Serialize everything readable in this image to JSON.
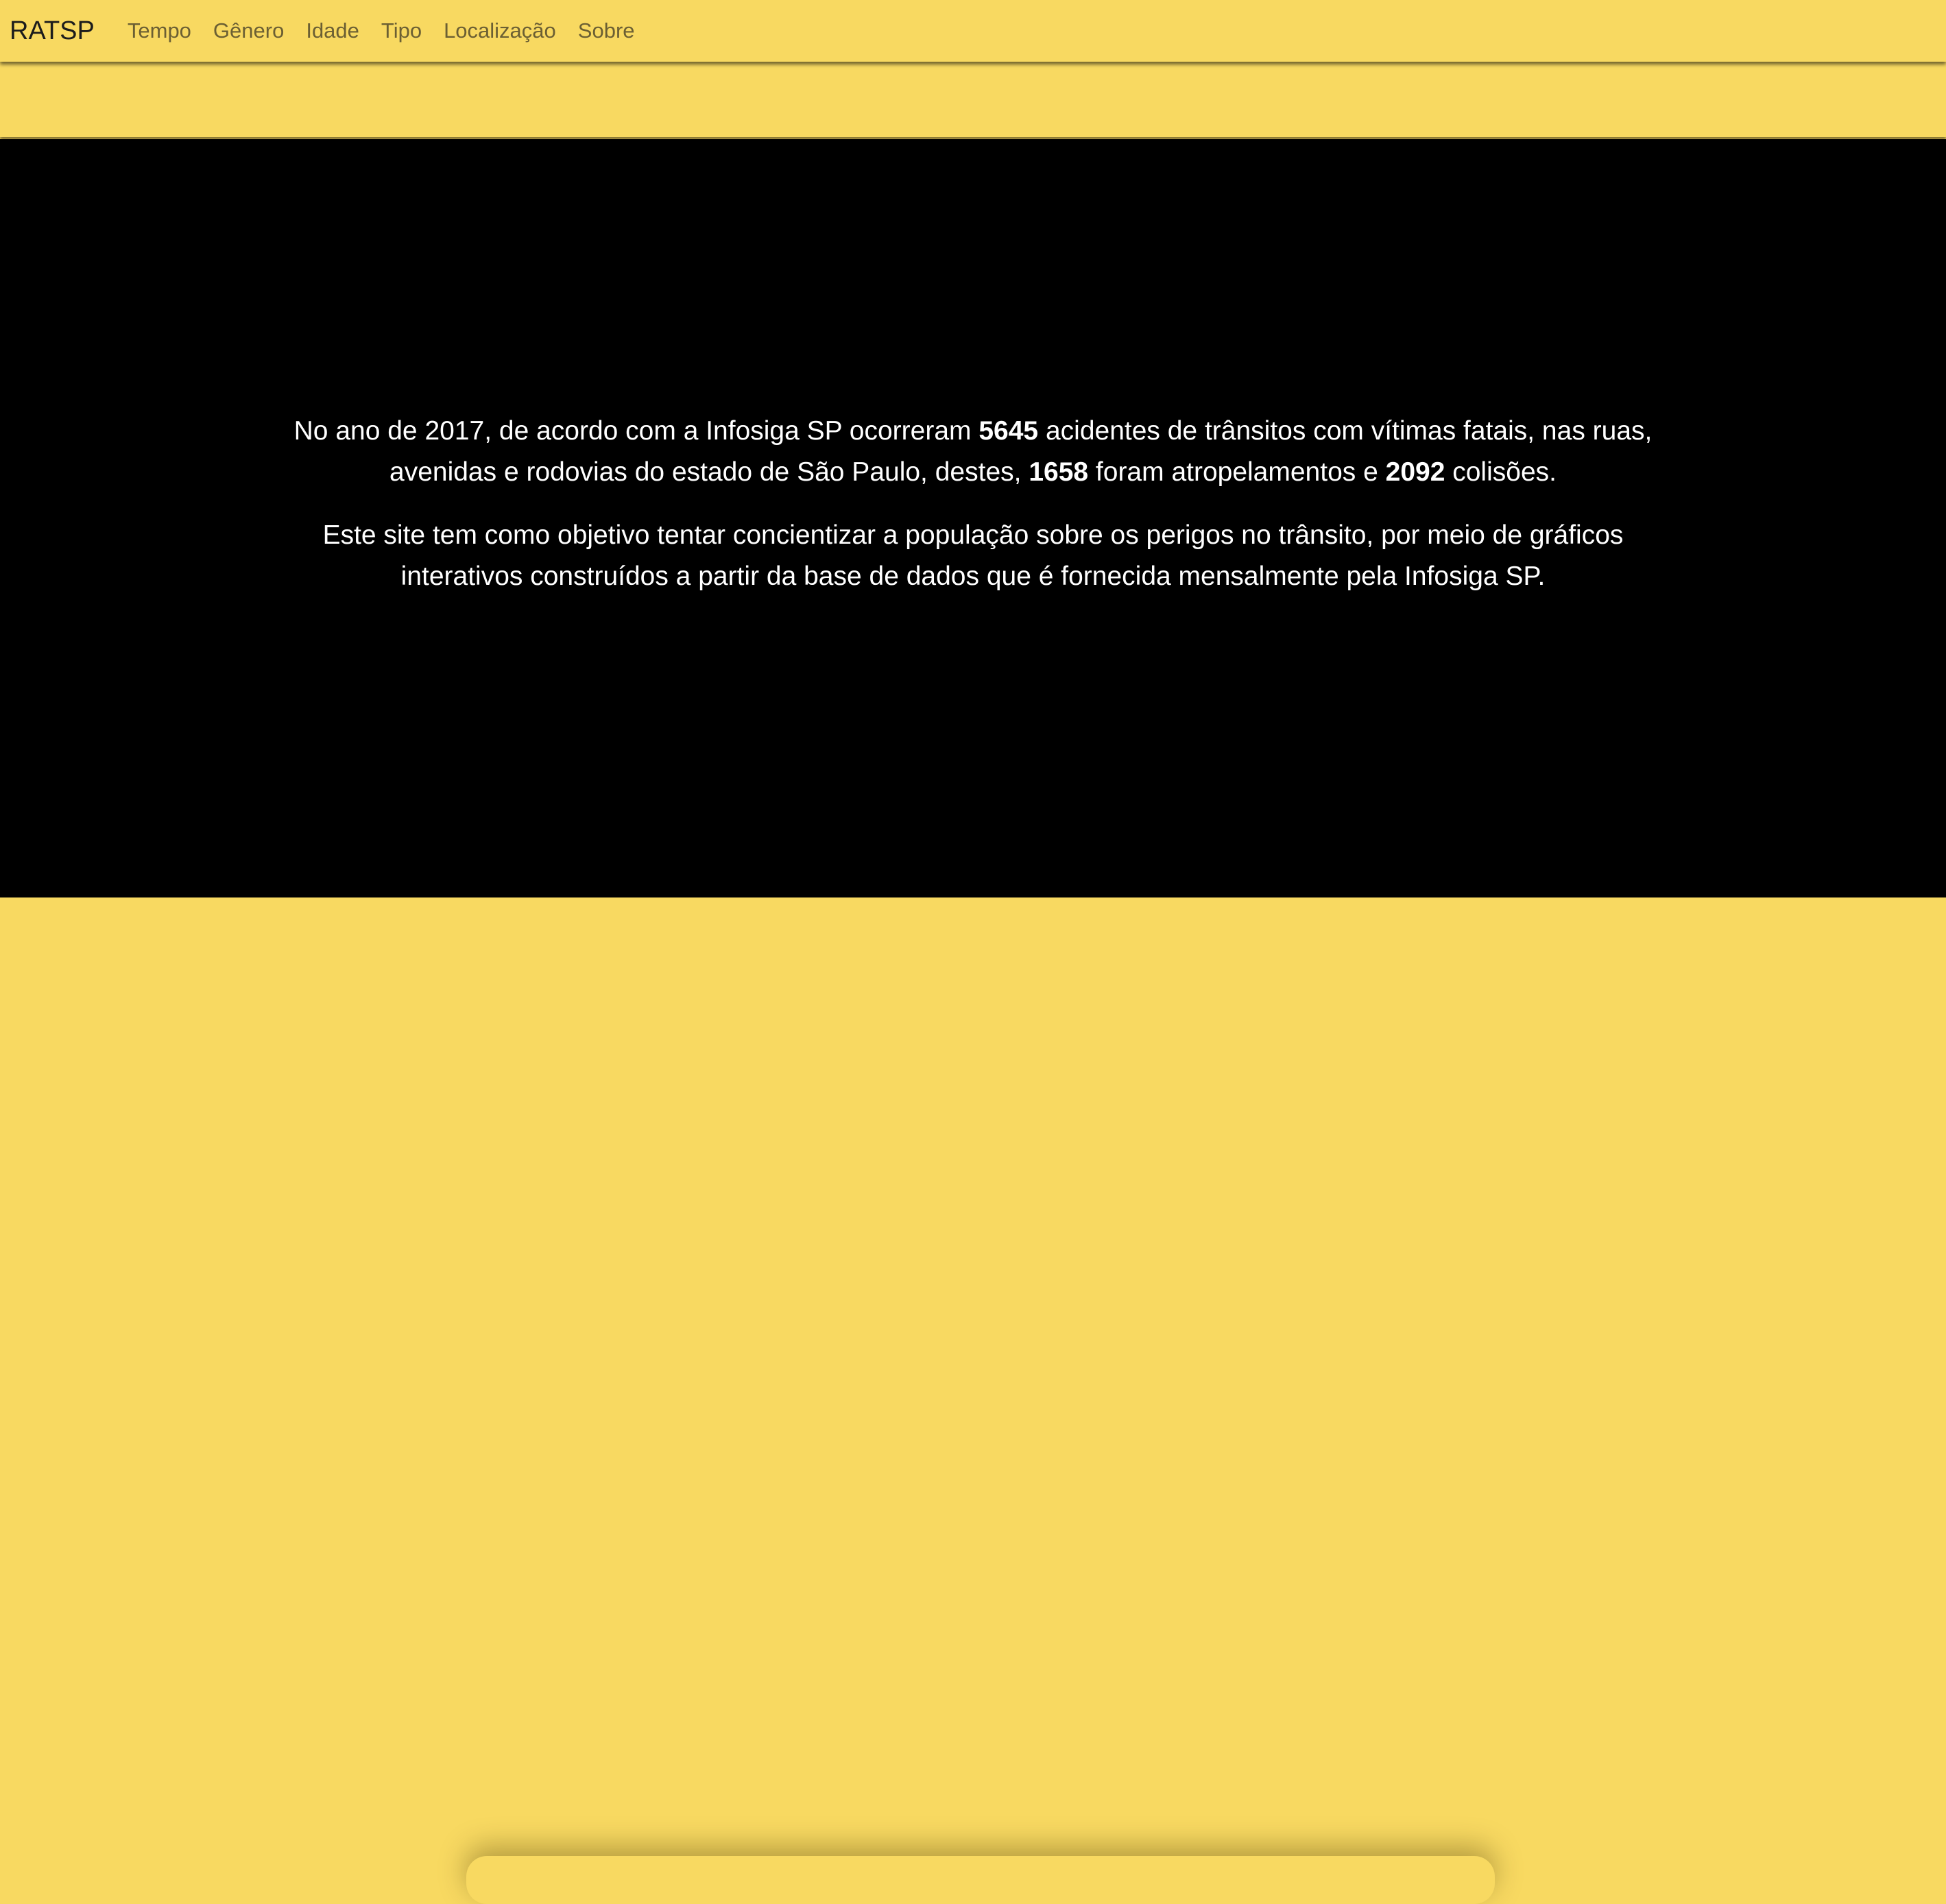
{
  "navbar": {
    "brand": "RATSP",
    "items": [
      {
        "label": "Tempo"
      },
      {
        "label": "Gênero"
      },
      {
        "label": "Idade"
      },
      {
        "label": "Tipo"
      },
      {
        "label": "Localização"
      },
      {
        "label": "Sobre"
      }
    ]
  },
  "hero": {
    "paragraph1": {
      "part1": "No ano de 2017, de acordo com a Infosiga SP ocorreram ",
      "total_accidents": "5645",
      "part2": " acidentes de trânsitos com vítimas fatais, nas ruas, avenidas e rodovias do estado de São Paulo, destes, ",
      "pedestrian_accidents": "1658",
      "part3": " foram atropelamentos e ",
      "collisions": "2092",
      "part4": " colisões."
    },
    "paragraph2": "Este site tem como objetivo tentar concientizar a população sobre os perigos no trânsito, por meio de gráficos interativos construídos a partir da base de dados que é fornecida mensalmente pela Infosiga SP."
  },
  "colors": {
    "accent": "#f8d961",
    "hero_background": "#000000",
    "hero_text": "#ffffff",
    "nav_text": "#6b5f33"
  }
}
